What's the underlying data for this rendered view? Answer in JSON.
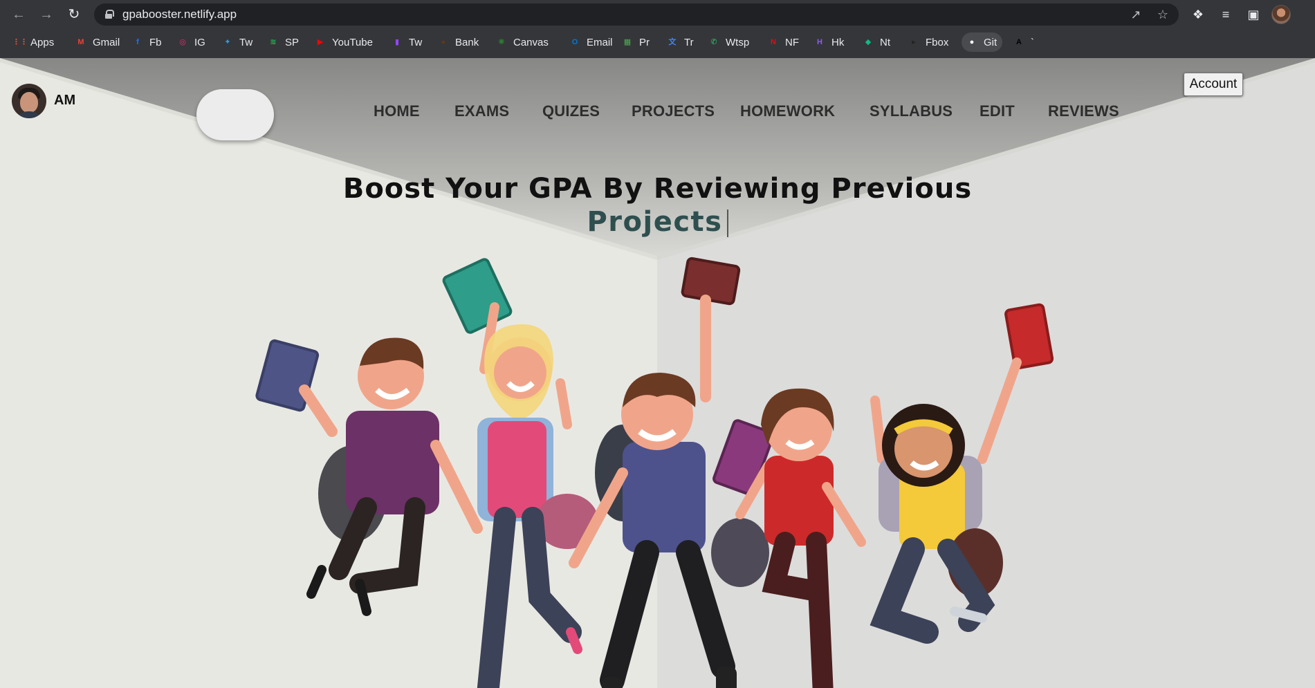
{
  "browser": {
    "url": "gpabooster.netlify.app",
    "bookmarks": [
      {
        "label": "Apps",
        "icon": "apps-grid-icon",
        "color": "#ea4335"
      },
      {
        "label": "Gmail",
        "icon": "gmail-icon",
        "color": "#ea4335"
      },
      {
        "label": "Fb",
        "icon": "facebook-icon",
        "color": "#1877f2"
      },
      {
        "label": "IG",
        "icon": "instagram-icon",
        "color": "#e1306c"
      },
      {
        "label": "Tw",
        "icon": "twitter-icon",
        "color": "#1da1f2"
      },
      {
        "label": "SP",
        "icon": "spotify-icon",
        "color": "#1db954"
      },
      {
        "label": "YouTube",
        "icon": "youtube-icon",
        "color": "#ff0000"
      },
      {
        "label": "Tw",
        "icon": "twitch-icon",
        "color": "#9146ff"
      },
      {
        "label": "Bank",
        "icon": "bank-icon",
        "color": "#5a3a1a"
      },
      {
        "label": "Canvas",
        "icon": "canvas-icon",
        "color": "#2e7d32"
      },
      {
        "label": "Email",
        "icon": "outlook-icon",
        "color": "#0078d4"
      },
      {
        "label": "Pr",
        "icon": "sheet-icon",
        "color": "#4caf50"
      },
      {
        "label": "Tr",
        "icon": "translate-icon",
        "color": "#4285f4"
      },
      {
        "label": "Wtsp",
        "icon": "whatsapp-icon",
        "color": "#25d366"
      },
      {
        "label": "NF",
        "icon": "netflix-icon",
        "color": "#e50914"
      },
      {
        "label": "Hk",
        "icon": "hackerrank-icon",
        "color": "#8b5cf6"
      },
      {
        "label": "Nt",
        "icon": "notion-diamond-icon",
        "color": "#10b981"
      },
      {
        "label": "Fbox",
        "icon": "fbox-play-icon",
        "color": "#222222"
      },
      {
        "label": "Git",
        "icon": "github-icon",
        "color": "#ffffff"
      },
      {
        "label": "`",
        "icon": "font-a-icon",
        "color": "#000000"
      }
    ]
  },
  "site": {
    "initials": "AM",
    "nav": [
      "HOME",
      "EXAMS",
      "QUIZES",
      "PROJECTS",
      "HOMEWORK",
      "SYLLABUS",
      "EDIT",
      "REVIEWS"
    ],
    "account_label": "Account",
    "hero_title": "Boost Your GPA By Reviewing Previous",
    "hero_typed": "Projects"
  },
  "colors": {
    "hero_typed": "#2f4f4f",
    "header_band": "#8c8c8a"
  }
}
